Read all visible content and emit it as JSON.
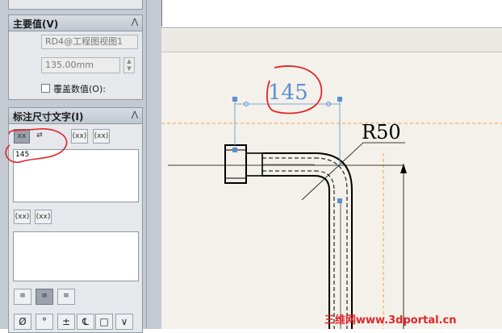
{
  "primary_value": {
    "title": "主要值(V)",
    "reference": "RD4@工程图视图1",
    "value": "135.00mm",
    "override_label": "覆盖数值(O):"
  },
  "dimension_text": {
    "title": "标注尺寸文字(I)",
    "text_value": "145",
    "paren_buttons": [
      "(xx)",
      "(xx)"
    ]
  },
  "justify_buttons": [
    "left-align",
    "center-align",
    "right-align"
  ],
  "symbols": [
    "Ø",
    "°",
    "±",
    "℄",
    "□",
    "∨"
  ],
  "drawing": {
    "dimension_text": "145",
    "radius_text": "R50"
  },
  "watermark": "三维网www.3dportal.cn",
  "colors": {
    "panel_bg": "#c3cad2",
    "sheet_bg": "#f3f1e9",
    "dimension_blue": "#5a8fd0",
    "annotation_red": "#e0262a",
    "construction_orange": "#f0a050"
  }
}
